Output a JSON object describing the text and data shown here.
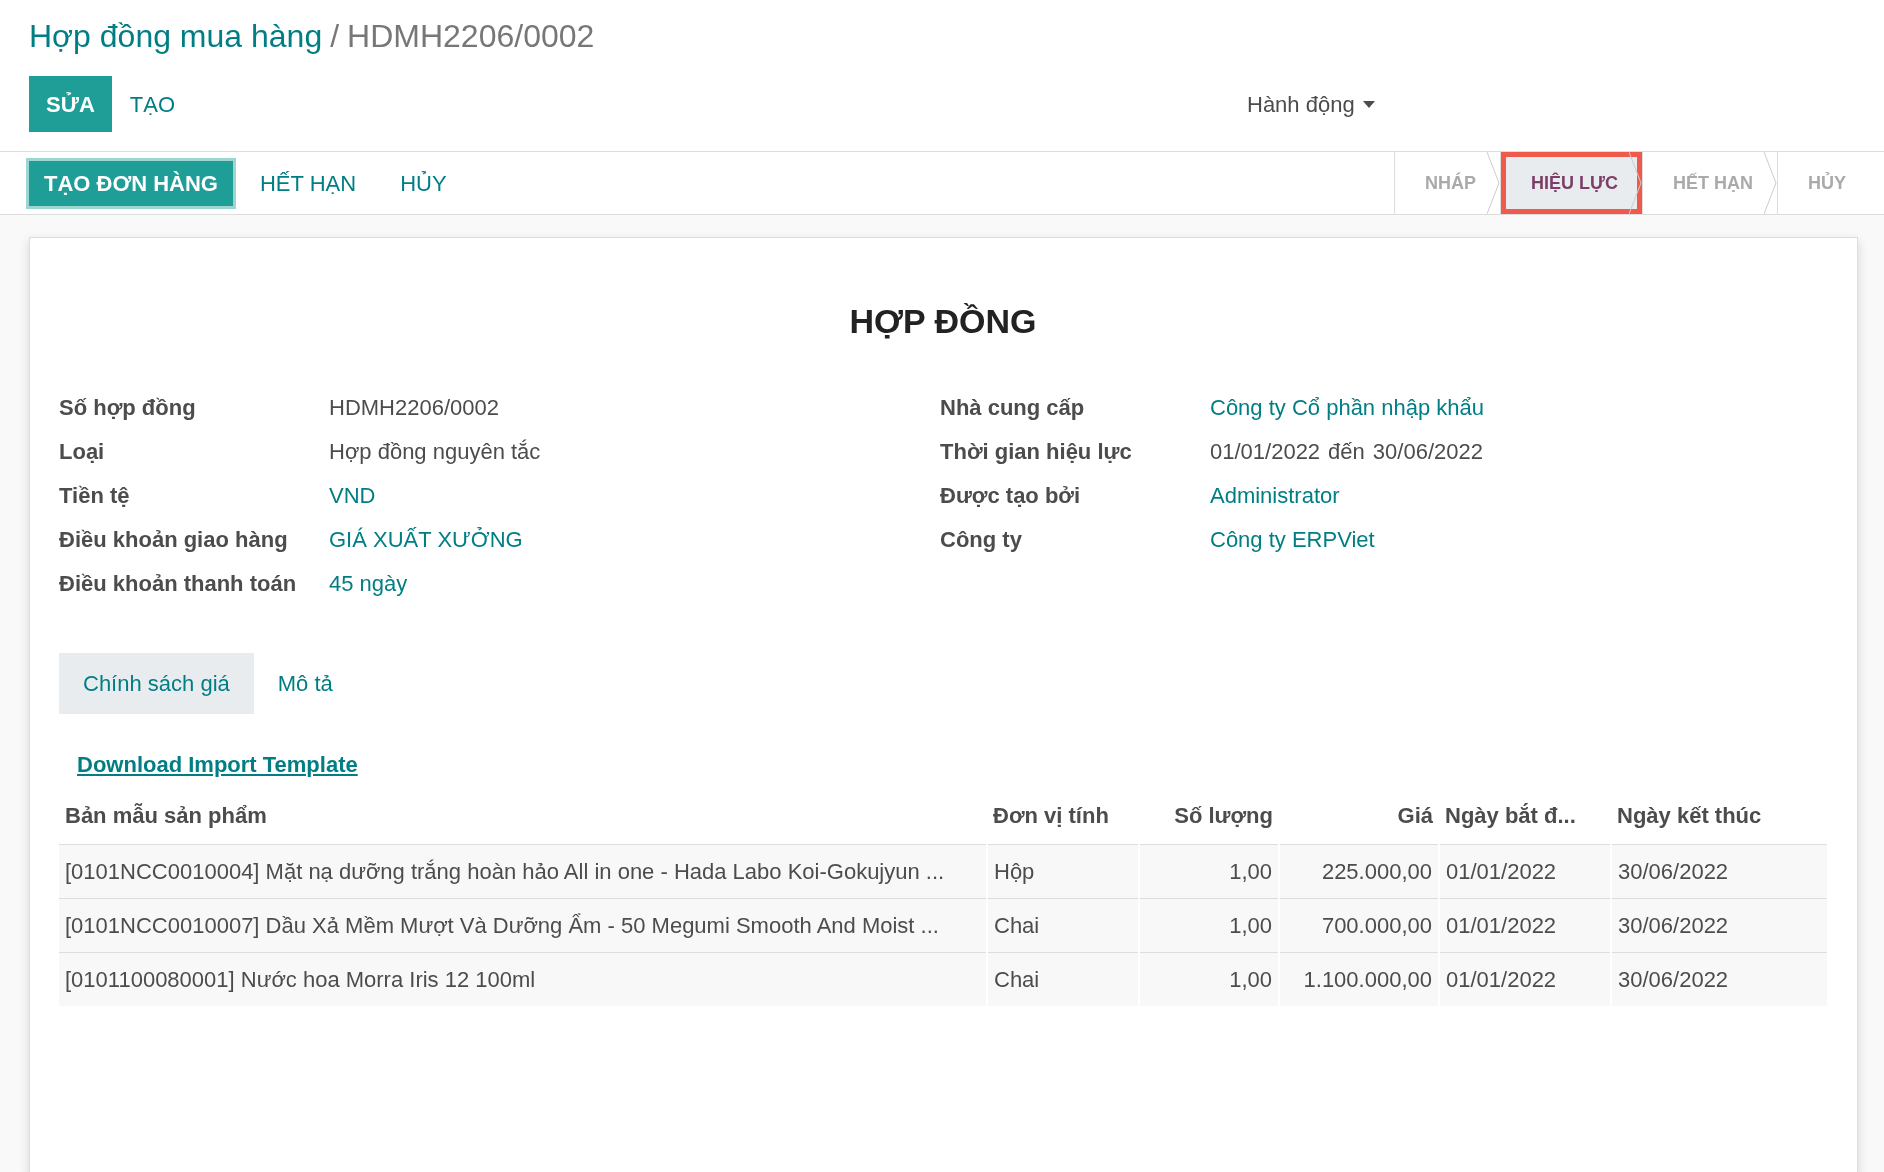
{
  "breadcrumb": {
    "separator": "/",
    "items": [
      {
        "label": "Hợp đồng mua hàng",
        "link": true
      },
      {
        "label": "HDMH2206/0002",
        "link": false
      }
    ]
  },
  "control_buttons": [
    {
      "label": "SỬA",
      "primary": true
    },
    {
      "label": "TẠO",
      "primary": false
    }
  ],
  "action_menu": {
    "label": "Hành động"
  },
  "header_buttons": [
    {
      "label": "TẠO ĐƠN HÀNG",
      "primary": true
    },
    {
      "label": "HẾT HẠN",
      "primary": false
    },
    {
      "label": "HỦY",
      "primary": false
    }
  ],
  "status_stages": [
    {
      "label": "NHÁP",
      "selected": false,
      "highlighted": false
    },
    {
      "label": "HIỆU LỰC",
      "selected": true,
      "highlighted": true
    },
    {
      "label": "HẾT HẠN",
      "selected": false,
      "highlighted": false
    },
    {
      "label": "HỦY",
      "selected": false,
      "highlighted": false
    }
  ],
  "form_title": "HỢP ĐỒNG",
  "left_fields": [
    {
      "label": "Số hợp đồng",
      "value": "HDMH2206/0002",
      "link": false
    },
    {
      "label": "Loại",
      "value": "Hợp đồng nguyên tắc",
      "link": false
    },
    {
      "label": "Tiền tệ",
      "value": "VND",
      "link": true
    },
    {
      "label": "Điều khoản giao hàng",
      "value": "GIÁ XUẤT XƯỞNG",
      "link": true
    },
    {
      "label": "Điều khoản thanh toán",
      "value": "45 ngày",
      "link": true
    }
  ],
  "right_fields": [
    {
      "label": "Nhà cung cấp",
      "value": "Công ty Cổ phần nhập khẩu",
      "link": true
    },
    {
      "label": "Thời gian hiệu lực",
      "value": "01/01/2022",
      "value_to": "30/06/2022",
      "separator": "đến"
    },
    {
      "label": "Được tạo bởi",
      "value": "Administrator",
      "link": true
    },
    {
      "label": "Công ty",
      "value": "Công ty ERPViet",
      "link": true
    }
  ],
  "notebook_tabs": [
    {
      "label": "Chính sách giá",
      "selected": true
    },
    {
      "label": "Mô tả",
      "selected": false
    }
  ],
  "download_link": "Download Import Template",
  "table": {
    "columns": [
      "Bản mẫu sản phẩm",
      "Đơn vị tính",
      "Số lượng",
      "Giá",
      "Ngày bắt đ...",
      "Ngày kết thúc"
    ],
    "rows": [
      [
        "[0101NCC0010004] Mặt nạ dưỡng trắng hoàn hảo All in one - Hada Labo Koi-Gokujyun ...",
        "Hộp",
        "1,00",
        "225.000,00",
        "01/01/2022",
        "30/06/2022"
      ],
      [
        "[0101NCC0010007] Dầu Xả Mềm Mượt Và Dưỡng Ẩm - 50 Megumi Smooth And Moist ...",
        "Chai",
        "1,00",
        "700.000,00",
        "01/01/2022",
        "30/06/2022"
      ],
      [
        "[0101100080001] Nước hoa Morra Iris 12 100ml",
        "Chai",
        "1,00",
        "1.100.000,00",
        "01/01/2022",
        "30/06/2022"
      ]
    ]
  }
}
